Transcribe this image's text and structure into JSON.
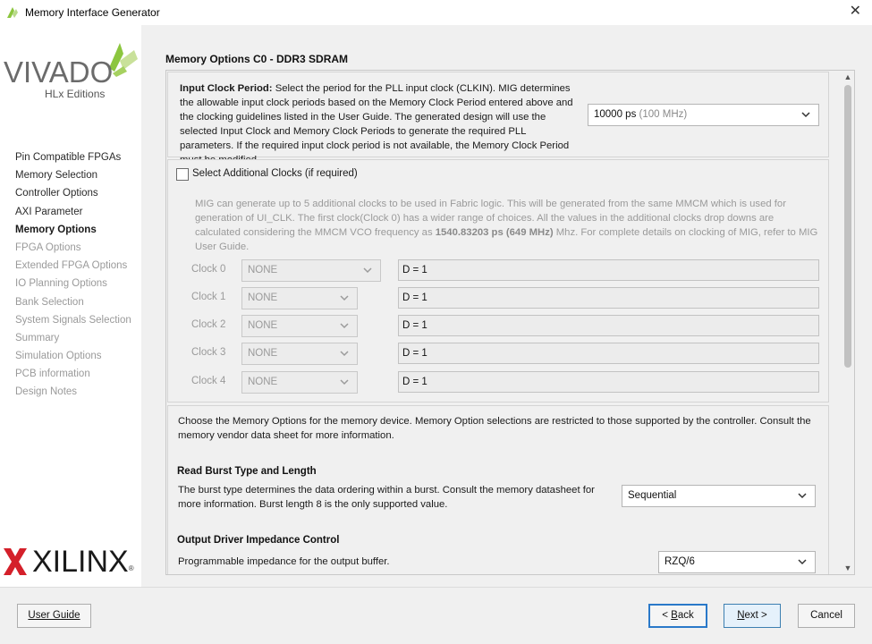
{
  "window": {
    "title": "Memory Interface Generator",
    "close_glyph": "✕"
  },
  "logos": {
    "vivado": "VIVADO",
    "vivado_sub": "HLx Editions",
    "xilinx": "XILINX",
    "xilinx_reg": "®"
  },
  "sidebar": {
    "items": [
      {
        "label": "Pin Compatible FPGAs",
        "state": "normal"
      },
      {
        "label": "Memory Selection",
        "state": "normal"
      },
      {
        "label": "Controller Options",
        "state": "normal"
      },
      {
        "label": "AXI Parameter",
        "state": "normal"
      },
      {
        "label": "Memory Options",
        "state": "active"
      },
      {
        "label": "FPGA Options",
        "state": "disabled"
      },
      {
        "label": "Extended FPGA Options",
        "state": "disabled"
      },
      {
        "label": "IO Planning Options",
        "state": "disabled"
      },
      {
        "label": "Bank Selection",
        "state": "disabled"
      },
      {
        "label": "System Signals Selection",
        "state": "disabled"
      },
      {
        "label": "Summary",
        "state": "disabled"
      },
      {
        "label": "Simulation Options",
        "state": "disabled"
      },
      {
        "label": "PCB information",
        "state": "disabled"
      },
      {
        "label": "Design Notes",
        "state": "disabled"
      }
    ]
  },
  "main": {
    "section_title": "Memory Options C0 - DDR3 SDRAM",
    "input_clock": {
      "heading": "Input Clock Period:",
      "description": " Select the period for the PLL input clock (CLKIN). MIG determines the allowable input clock periods based on the Memory Clock Period entered above and the clocking guidelines listed in the User Guide. The generated design will use the selected Input Clock and Memory Clock Periods to generate the required PLL parameters. If the required input clock period is not available, the Memory Clock Period must be modified.",
      "value": "10000 ps",
      "value_hint": "(100 MHz)"
    },
    "additional_clocks": {
      "checkbox_label": "Select Additional Clocks (if required)",
      "checked": false,
      "description_pre": "MIG can generate up to 5 additional clocks to be used in Fabric logic. This will be generated from the same MMCM which is used for generation of UI_CLK. The first clock(Clock 0) has a wider range of choices. All the values in the additional clocks drop downs are calculated considering the MMCM VCO frequency as ",
      "vco_value": "1540.83203 ps (649 MHz)",
      "description_post": " Mhz. For complete details on clocking of MIG, refer to MIG User Guide.",
      "clocks": [
        {
          "label": "Clock 0",
          "select": "NONE",
          "divider": "D = 1"
        },
        {
          "label": "Clock 1",
          "select": "NONE",
          "divider": "D = 1"
        },
        {
          "label": "Clock 2",
          "select": "NONE",
          "divider": "D = 1"
        },
        {
          "label": "Clock 3",
          "select": "NONE",
          "divider": "D = 1"
        },
        {
          "label": "Clock 4",
          "select": "NONE",
          "divider": "D = 1"
        }
      ]
    },
    "memory_options_intro": "Choose the Memory Options for the memory device. Memory Option selections are restricted to those supported by the controller. Consult the memory vendor data sheet for more information.",
    "read_burst": {
      "heading": "Read Burst Type and Length",
      "description": "The burst type determines the data ordering within a burst. Consult the memory datasheet for more information. Burst length 8 is the only supported value.",
      "value": "Sequential"
    },
    "output_driver": {
      "heading": "Output Driver Impedance Control",
      "description": "Programmable impedance for the output buffer.",
      "value": "RZQ/6"
    }
  },
  "footer": {
    "user_guide": "User Guide",
    "back_prefix": "< ",
    "back_letter": "B",
    "back_rest": "ack",
    "next_letter": "N",
    "next_rest": "ext >",
    "cancel": "Cancel"
  },
  "colors": {
    "accent_green": "#8cc63f",
    "xilinx_red": "#d4202a",
    "focus_blue": "#2a79c9"
  }
}
